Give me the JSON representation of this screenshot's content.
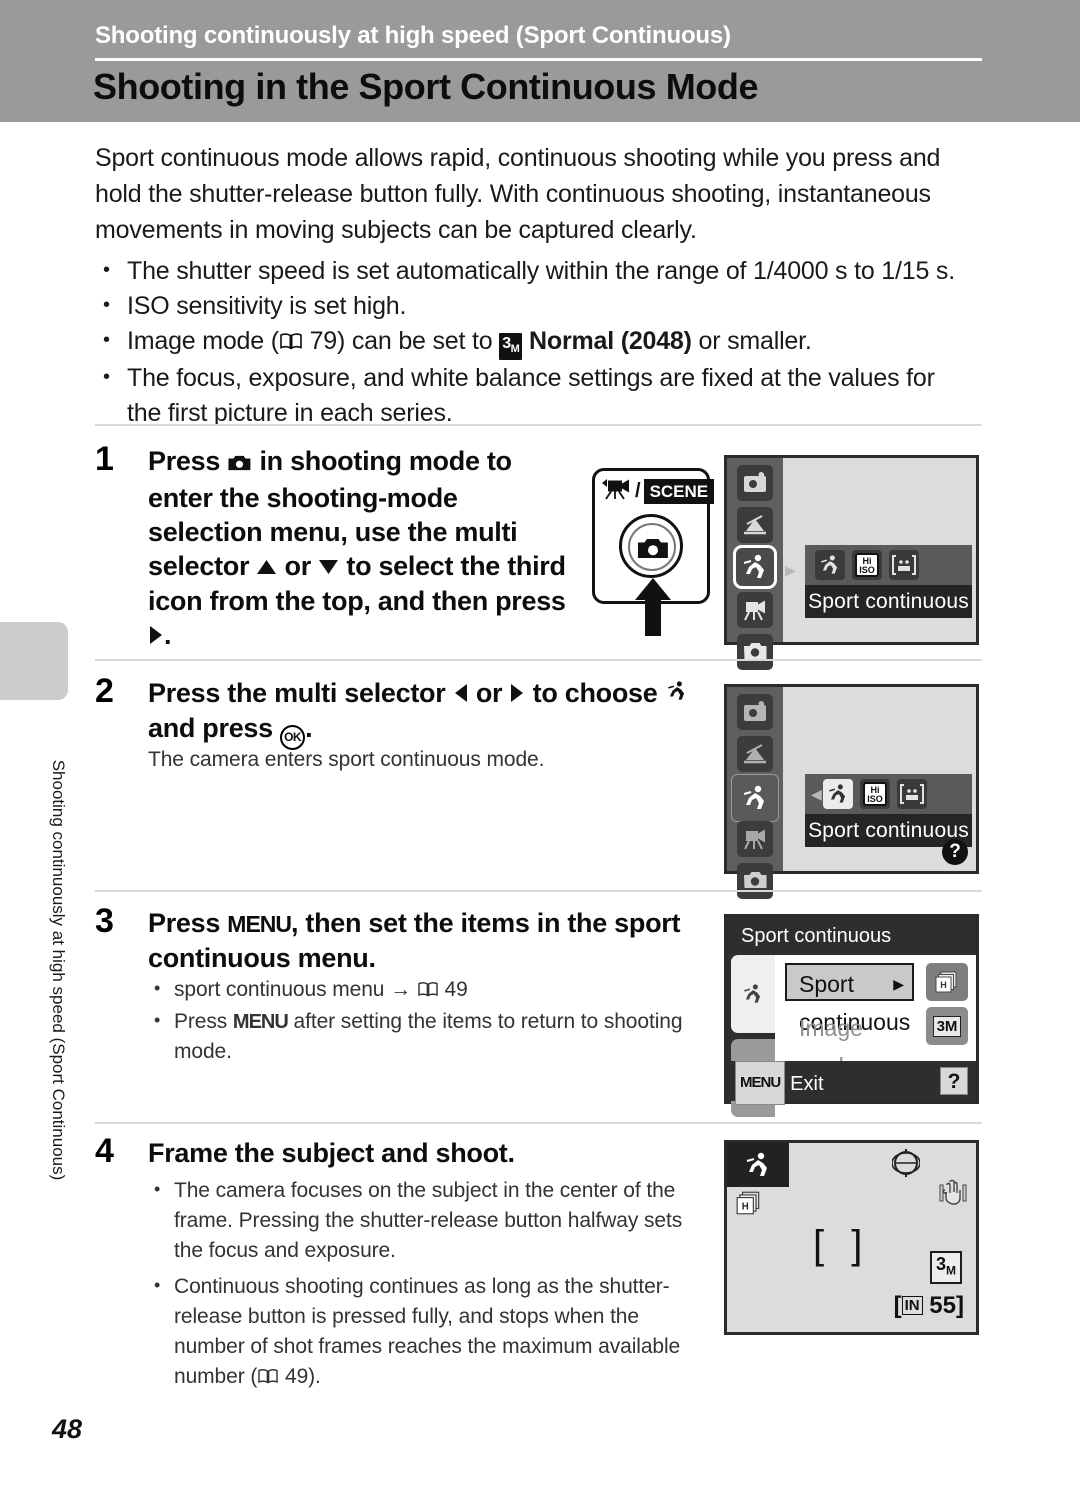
{
  "header": {
    "kicker": "Shooting continuously at high speed (Sport Continuous)",
    "title": "Shooting in the Sport Continuous Mode"
  },
  "side_tab": {
    "label": "Shooting continuously at high speed (Sport Continuous)"
  },
  "intro": {
    "paragraph": "Sport continuous mode allows rapid, continuous shooting while you press and hold the shutter-release button fully. With continuous shooting, instantaneous movements in moving subjects can be captured clearly.",
    "bullets": [
      {
        "text": "The shutter speed is set automatically within the range of 1/4000 s to 1/15 s."
      },
      {
        "text": "ISO sensitivity is set high."
      },
      {
        "text_before": "Image mode (",
        "page_ref": "79",
        "text_mid": ") can be set to ",
        "icon": "3m",
        "bold_text": "Normal (2048)",
        "text_after": " or smaller."
      },
      {
        "text": "The focus, exposure, and white balance settings are fixed at the values for the first picture in each series."
      }
    ]
  },
  "steps": [
    {
      "number": "1",
      "heading_parts": {
        "p1": "Press ",
        "icon1": "camera-mode-button-icon",
        "p2": " in shooting mode to enter the shooting-mode selection menu, use the multi selector ",
        "icon2": "triangle-up-icon",
        "p3": " or ",
        "icon3": "triangle-down-icon",
        "p4": " to select the third icon from the top, and then press ",
        "icon4": "triangle-right-icon",
        "p5": "."
      },
      "heading_plain": "Press [camera] in shooting mode to enter the shooting-mode selection menu, use the multi selector [up] or [down] to select the third icon from the top, and then press [right]."
    },
    {
      "number": "2",
      "heading_plain": "Press the multi selector [left] or [right] to choose [sport] and press [OK].",
      "note": "The camera enters sport continuous mode."
    },
    {
      "number": "3",
      "heading_plain": "Press MENU, then set the items in the sport continuous menu.",
      "menu_key": "MENU",
      "bullets": [
        {
          "text_before": "sport continuous menu ",
          "arrow": "→",
          "page_ref": "49"
        },
        {
          "text_before": "Press ",
          "key": "MENU",
          "text_after": " after setting the items to return to shooting mode."
        }
      ]
    },
    {
      "number": "4",
      "heading_plain": "Frame the subject and shoot.",
      "bullets": [
        {
          "text": "The camera focuses on the subject in the center of the frame. Pressing the shutter-release button halfway sets the focus and exposure."
        },
        {
          "text_before": "Continuous shooting continues as long as the shutter-release button is pressed fully, and stops when the number of shot frames reaches the maximum available number (",
          "page_ref": "49",
          "text_after": ")."
        }
      ]
    }
  ],
  "camera_diagram": {
    "movie_icon": "movie-camera-icon",
    "separator": "/",
    "scene_label": "SCENE",
    "dial_icon": "camera-mode-button-icon",
    "press_arrow": "arrow-up-icon"
  },
  "screens": {
    "screen1": {
      "name": "shooting-mode-selection-menu",
      "rail_items": [
        "auto-portrait-icon",
        "scene-icon",
        "sport-continuous-icon",
        "movie-icon",
        "auto-mode-icon"
      ],
      "selected_rail_index": 2,
      "options": [
        "sport-continuous-icon",
        "high-iso-icon",
        "smile-icon"
      ],
      "selected_option_index": -1,
      "caption": "Sport continuous"
    },
    "screen2": {
      "name": "sport-continuous-option-selection",
      "rail_items": [
        "auto-portrait-icon",
        "scene-icon",
        "sport-continuous-icon",
        "movie-icon",
        "auto-mode-icon"
      ],
      "selected_rail_index": 2,
      "options": [
        "sport-continuous-icon",
        "high-iso-icon",
        "smile-icon"
      ],
      "selected_option_index": 0,
      "caption": "Sport continuous",
      "help_badge": "?"
    },
    "screen3": {
      "name": "sport-continuous-menu",
      "title": "Sport continuous",
      "rows": [
        {
          "label": "Sport continuous",
          "selected": true,
          "badge": "multi-shot-icon"
        },
        {
          "label": "Image mode",
          "selected": false,
          "badge": "3M"
        }
      ],
      "tabs": [
        "sport-continuous-tab-icon",
        "setup-wrench-tab-icon"
      ],
      "footer_key": "MENU",
      "footer_label": "Exit",
      "help_badge": "?"
    },
    "screen4": {
      "name": "live-view-display",
      "mode_icon": "sport-continuous-icon",
      "continuous_icon": "multi-shot-icon",
      "top_right_icon": "date-imprint-icon",
      "vr_icon": "vibration-reduction-icon",
      "focus_brackets": "[ ]",
      "image_mode_badge": "3M",
      "memory_label": "IN",
      "shots_remaining": "55"
    }
  },
  "page_number": "48"
}
